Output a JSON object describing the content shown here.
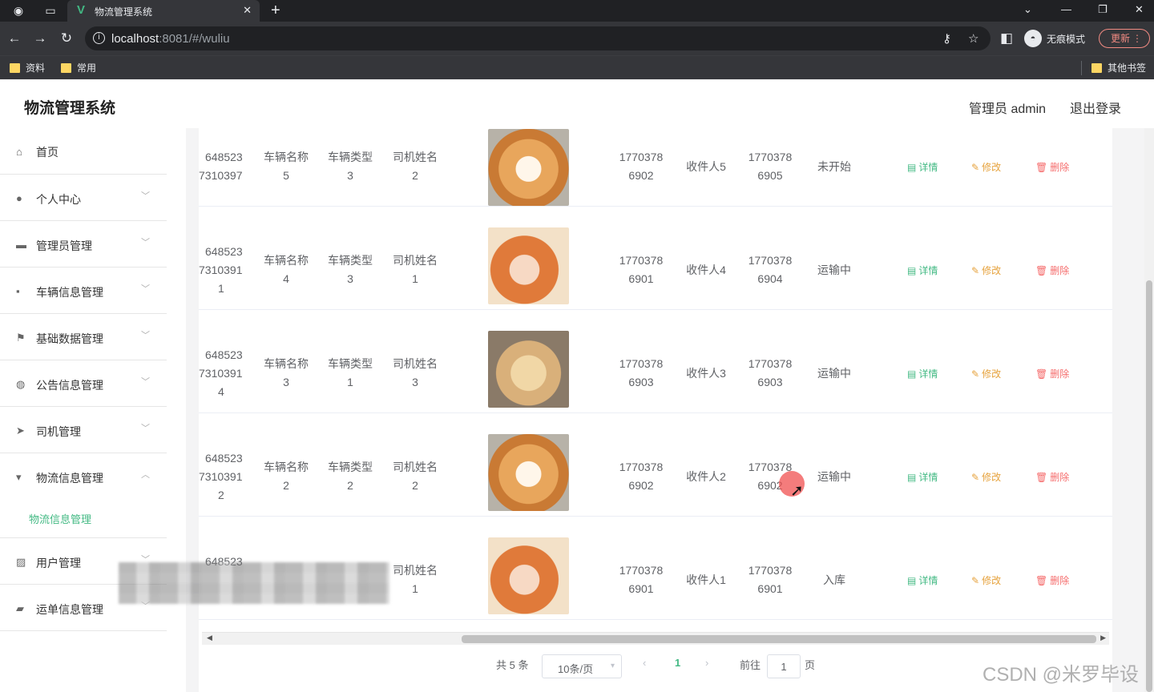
{
  "browser": {
    "tab_title": "物流管理系统",
    "url_host": "localhost",
    "url_rest": ":8081/#/wuliu",
    "incognito_label": "无痕模式",
    "update_label": "更新",
    "bookmarks": [
      "资料",
      "常用"
    ],
    "other_bookmarks": "其他书签"
  },
  "app": {
    "title": "物流管理系统",
    "user_label": "管理员 admin",
    "logout_label": "退出登录",
    "accent_color": "#42b983"
  },
  "sidebar": {
    "items": [
      {
        "label": "首页",
        "icon": "home-icon"
      },
      {
        "label": "个人中心",
        "icon": "user-icon"
      },
      {
        "label": "管理员管理",
        "icon": "briefcase-icon"
      },
      {
        "label": "车辆信息管理",
        "icon": "chat-icon"
      },
      {
        "label": "基础数据管理",
        "icon": "flag-icon"
      },
      {
        "label": "公告信息管理",
        "icon": "bulb-icon"
      },
      {
        "label": "司机管理",
        "icon": "send-icon"
      },
      {
        "label": "物流信息管理",
        "icon": "monitor-icon"
      },
      {
        "label": "用户管理",
        "icon": "chart-icon"
      },
      {
        "label": "运单信息管理",
        "icon": "ticket-icon"
      }
    ],
    "submenu_active": "物流信息管理"
  },
  "table": {
    "rows": [
      {
        "id_l1": "648523",
        "id_l2": "7310397",
        "id_l3": "",
        "vehicle_name": [
          "车辆名称",
          "5"
        ],
        "vehicle_type": [
          "车辆类型",
          "3"
        ],
        "driver": [
          "司机姓名",
          "2"
        ],
        "image": "shiba-dog",
        "phone1": [
          "1770378",
          "6902"
        ],
        "receiver": "收件人5",
        "phone2": [
          "1770378",
          "6905"
        ],
        "status": "未开始"
      },
      {
        "id_l1": "648523",
        "id_l2": "7310391",
        "id_l3": "1",
        "vehicle_name": [
          "车辆名称",
          "4"
        ],
        "vehicle_type": [
          "车辆类型",
          "3"
        ],
        "driver": [
          "司机姓名",
          "1"
        ],
        "image": "smiling-girl",
        "phone1": [
          "1770378",
          "6901"
        ],
        "receiver": "收件人4",
        "phone2": [
          "1770378",
          "6904"
        ],
        "status": "运输中"
      },
      {
        "id_l1": "648523",
        "id_l2": "7310391",
        "id_l3": "4",
        "vehicle_name": [
          "车辆名称",
          "3"
        ],
        "vehicle_type": [
          "车辆类型",
          "1"
        ],
        "driver": [
          "司机姓名",
          "3"
        ],
        "image": "golden-puppy",
        "phone1": [
          "1770378",
          "6903"
        ],
        "receiver": "收件人3",
        "phone2": [
          "1770378",
          "6903"
        ],
        "status": "运输中"
      },
      {
        "id_l1": "648523",
        "id_l2": "7310391",
        "id_l3": "2",
        "vehicle_name": [
          "车辆名称",
          "2"
        ],
        "vehicle_type": [
          "车辆类型",
          "2"
        ],
        "driver": [
          "司机姓名",
          "2"
        ],
        "image": "shiba-dog",
        "phone1": [
          "1770378",
          "6902"
        ],
        "receiver": "收件人2",
        "phone2": [
          "1770378",
          "6902"
        ],
        "status": "运输中"
      },
      {
        "id_l1": "648523",
        "id_l2": "",
        "id_l3": "",
        "vehicle_name": [
          "",
          ""
        ],
        "vehicle_type": [
          "",
          ""
        ],
        "driver": [
          "司机姓名",
          "1"
        ],
        "image": "smiling-girl",
        "phone1": [
          "1770378",
          "6901"
        ],
        "receiver": "收件人1",
        "phone2": [
          "1770378",
          "6901"
        ],
        "status": "入库"
      }
    ],
    "actions": {
      "detail": "详情",
      "edit": "修改",
      "delete": "删除"
    }
  },
  "pagination": {
    "total": "共 5 条",
    "page_size": "10条/页",
    "current_page": "1",
    "goto_label": "前往",
    "goto_value": "1",
    "page_suffix": "页"
  },
  "watermark": "CSDN @米罗毕设"
}
